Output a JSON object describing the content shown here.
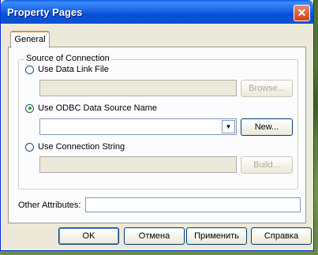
{
  "window": {
    "title": "Property Pages",
    "close_icon": "close-icon"
  },
  "tabs": [
    {
      "label": "General"
    }
  ],
  "source_group": {
    "legend": "Source of Connection",
    "data_link": {
      "label": "Use Data Link File",
      "value": "",
      "browse_label": "Browse..."
    },
    "odbc": {
      "label": "Use ODBC Data Source Name",
      "value": "",
      "new_label": "New..."
    },
    "connection_string": {
      "label": "Use Connection String",
      "value": "",
      "build_label": "Build..."
    },
    "selected": "odbc"
  },
  "other_attributes": {
    "label": "Other Attributes:",
    "value": ""
  },
  "buttons": {
    "ok": "OK",
    "cancel": "Отмена",
    "apply": "Применить",
    "help": "Справка"
  }
}
